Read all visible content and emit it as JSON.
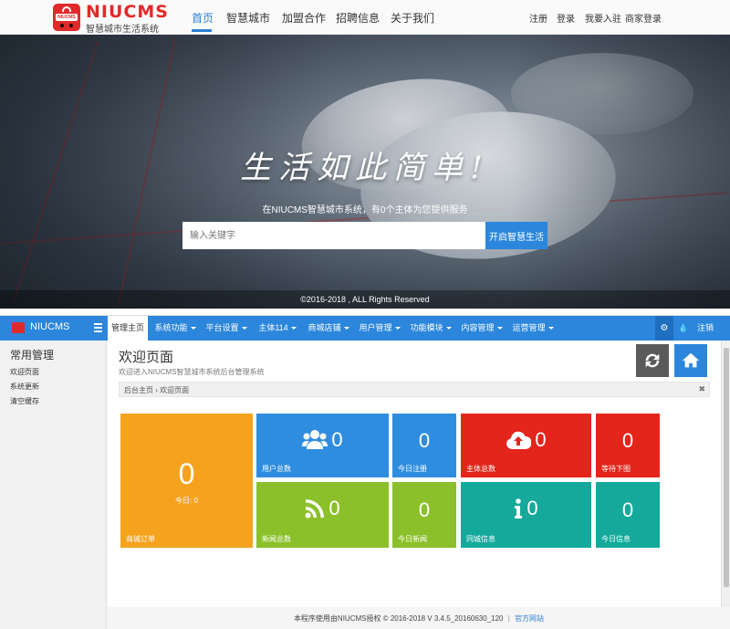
{
  "site": {
    "logo_text": "NIUCMS",
    "logo_subtitle": "智慧城市生活系统",
    "nav": [
      "首页",
      "智慧城市",
      "加盟合作",
      "招聘信息",
      "关于我们"
    ],
    "user_links": [
      "注册",
      "登录",
      "我要入驻",
      "商家登录"
    ]
  },
  "hero": {
    "slogan": "生活如此简单!",
    "tagline": "在NIUCMS智慧城市系统，有0个主体为您提供服务",
    "search_placeholder": "输入关键字",
    "search_button": "开启智慧生活",
    "copyright": "©2016-2018 , ALL Rights Reserved"
  },
  "admin": {
    "brand": "NIUCMS",
    "menu": [
      {
        "label": "管理主页",
        "dropdown": false
      },
      {
        "label": "系统功能",
        "dropdown": true
      },
      {
        "label": "平台设置",
        "dropdown": true
      },
      {
        "label": "主体114",
        "dropdown": true
      },
      {
        "label": "商城店铺",
        "dropdown": true
      },
      {
        "label": "用户管理",
        "dropdown": true
      },
      {
        "label": "功能模块",
        "dropdown": true
      },
      {
        "label": "内容管理",
        "dropdown": true
      },
      {
        "label": "运营管理",
        "dropdown": true
      }
    ],
    "logout": "注销",
    "sidebar": {
      "title": "常用管理",
      "links": [
        "欢迎页面",
        "系统更新",
        "清空缓存"
      ]
    },
    "page": {
      "title": "欢迎页面",
      "subtitle": "欢迎进入NIUCMS智慧城市系统后台管理系统",
      "breadcrumb": "后台主页 › 欢迎页面"
    },
    "tiles": {
      "orders": {
        "value": "0",
        "sub": "今日: 0",
        "label": "商城订单",
        "color": "#f5a31f",
        "icon": "none"
      },
      "users": {
        "value": "0",
        "label": "用户总数",
        "color": "#2f8ddf",
        "icon": "users-icon"
      },
      "today_reg": {
        "value": "0",
        "label": "今日注册",
        "color": "#2f8ddf",
        "icon": "none"
      },
      "subjects": {
        "value": "0",
        "label": "主体总数",
        "color": "#e3251b",
        "icon": "cloud-upload-icon"
      },
      "pending": {
        "value": "0",
        "label": "等待下图",
        "color": "#e3251b",
        "icon": "none"
      },
      "news": {
        "value": "0",
        "label": "新闻总数",
        "color": "#8bc02a",
        "icon": "rss-icon"
      },
      "today_news": {
        "value": "0",
        "label": "今日新闻",
        "color": "#8bc02a",
        "icon": "none"
      },
      "city_info": {
        "value": "0",
        "label": "同城信息",
        "color": "#14a99b",
        "icon": "info-icon"
      },
      "today_info": {
        "value": "0",
        "label": "今日信息",
        "color": "#14a99b",
        "icon": "none"
      }
    },
    "footer": {
      "text": "本程序使用由NIUCMS授权 © 2016-2018 V 3.4.5_20160630_120",
      "separator": "|",
      "link": "官方网站"
    }
  }
}
